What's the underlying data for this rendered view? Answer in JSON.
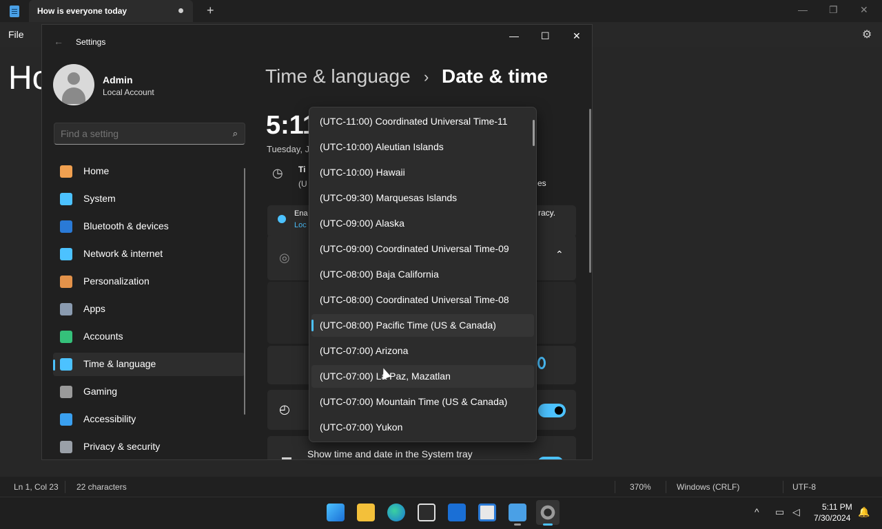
{
  "notepad": {
    "tab_title": "How is everyone today",
    "menu_file": "File",
    "doc_text": "Ho",
    "status": {
      "position": "Ln 1, Col 23",
      "chars": "22 characters",
      "zoom": "370%",
      "eol": "Windows (CRLF)",
      "encoding": "UTF-8"
    }
  },
  "settings": {
    "window_title": "Settings",
    "user": {
      "name": "Admin",
      "type": "Local Account"
    },
    "search_placeholder": "Find a setting",
    "nav": [
      {
        "label": "Home",
        "icon": "home-icon",
        "color": "#f0a050"
      },
      {
        "label": "System",
        "icon": "system-icon",
        "color": "#4cc2ff"
      },
      {
        "label": "Bluetooth & devices",
        "icon": "bluetooth-icon",
        "color": "#2a7ad6"
      },
      {
        "label": "Network & internet",
        "icon": "wifi-icon",
        "color": "#4cc2ff"
      },
      {
        "label": "Personalization",
        "icon": "brush-icon",
        "color": "#e3924a"
      },
      {
        "label": "Apps",
        "icon": "apps-icon",
        "color": "#8a9bb0"
      },
      {
        "label": "Accounts",
        "icon": "accounts-icon",
        "color": "#35c07a"
      },
      {
        "label": "Time & language",
        "icon": "time-language-icon",
        "color": "#4cc2ff",
        "selected": true
      },
      {
        "label": "Gaming",
        "icon": "gaming-icon",
        "color": "#9a9a9a"
      },
      {
        "label": "Accessibility",
        "icon": "accessibility-icon",
        "color": "#3aa0f0"
      },
      {
        "label": "Privacy & security",
        "icon": "shield-icon",
        "color": "#9aa0a8"
      }
    ],
    "breadcrumb": {
      "parent": "Time & language",
      "current": "Date & time"
    },
    "time": "5:11",
    "date_partial": "Tuesday, J",
    "tz_row": {
      "title_partial": "Ti",
      "sub_partial": "(U",
      "right_partial": "es"
    },
    "info_row": {
      "line1": "Ena",
      "line2": "Loc",
      "right": "racy."
    },
    "tray_row_label": "Show time and date in the System tray",
    "timezone_options": [
      "(UTC-11:00) Coordinated Universal Time-11",
      "(UTC-10:00) Aleutian Islands",
      "(UTC-10:00) Hawaii",
      "(UTC-09:30) Marquesas Islands",
      "(UTC-09:00) Alaska",
      "(UTC-09:00) Coordinated Universal Time-09",
      "(UTC-08:00) Baja California",
      "(UTC-08:00) Coordinated Universal Time-08",
      "(UTC-08:00) Pacific Time (US & Canada)",
      "(UTC-07:00) Arizona",
      "(UTC-07:00) La Paz, Mazatlan",
      "(UTC-07:00) Mountain Time (US & Canada)",
      "(UTC-07:00) Yukon"
    ],
    "timezone_selected_index": 8,
    "timezone_hover_index": 10
  },
  "taskbar": {
    "time": "5:11 PM",
    "date": "7/30/2024"
  },
  "colors": {
    "accent": "#4cc2ff"
  }
}
